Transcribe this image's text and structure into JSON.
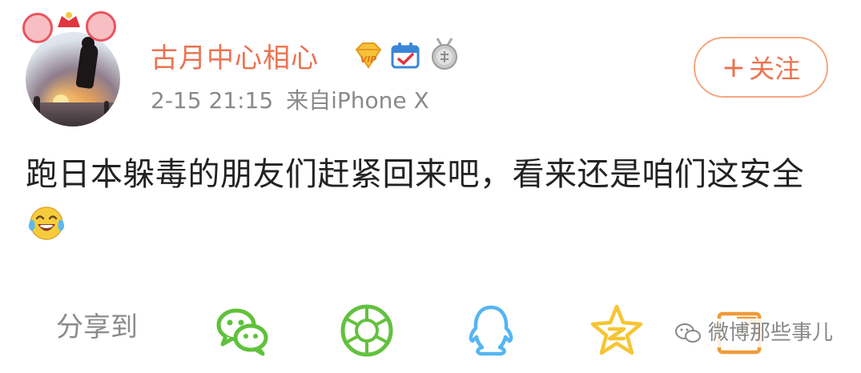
{
  "post": {
    "username": "古月中心相心",
    "time": "2-15 21:15",
    "source": "来自iPhone X",
    "follow_label": "关注",
    "content": "跑日本躲毒的朋友们赶紧回来吧，看来还是咱们这安全",
    "emoji": "laugh-cry-emoji"
  },
  "badges": [
    "vip-badge-icon",
    "checkin-calendar-icon",
    "medal-badge-icon"
  ],
  "share": {
    "label": "分享到",
    "targets": [
      "wechat-icon",
      "moments-icon",
      "qq-icon",
      "qzone-icon",
      "more-share-icon"
    ]
  },
  "watermark": "微博那些事儿",
  "colors": {
    "accent": "#eb7350",
    "wechat": "#5fc13b",
    "qq": "#56b5f2",
    "qzone": "#f6c532",
    "more": "#f19a38"
  }
}
